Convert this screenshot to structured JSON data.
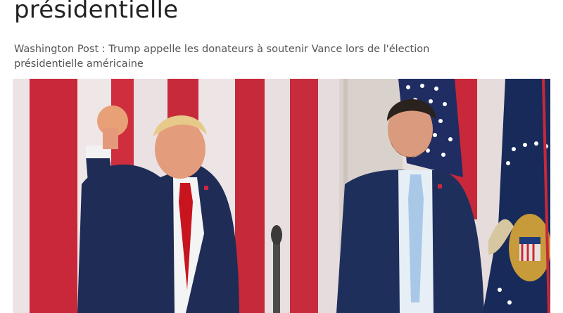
{
  "article": {
    "headline": "présidentielle",
    "subtitle": "Washington Post : Trump appelle les donateurs à soutenir Vance lors de l'élection présidentielle américaine"
  },
  "colors": {
    "headline_text": "#222222",
    "subtitle_text": "#555555",
    "flag_red": "#c8283a",
    "flag_stripe_light": "#e8dcdd",
    "suit_navy": "#1e2c56",
    "tie_red": "#c8141e",
    "tie_light_blue": "#a9c8e8",
    "presidential_flag_navy": "#172a5a"
  }
}
